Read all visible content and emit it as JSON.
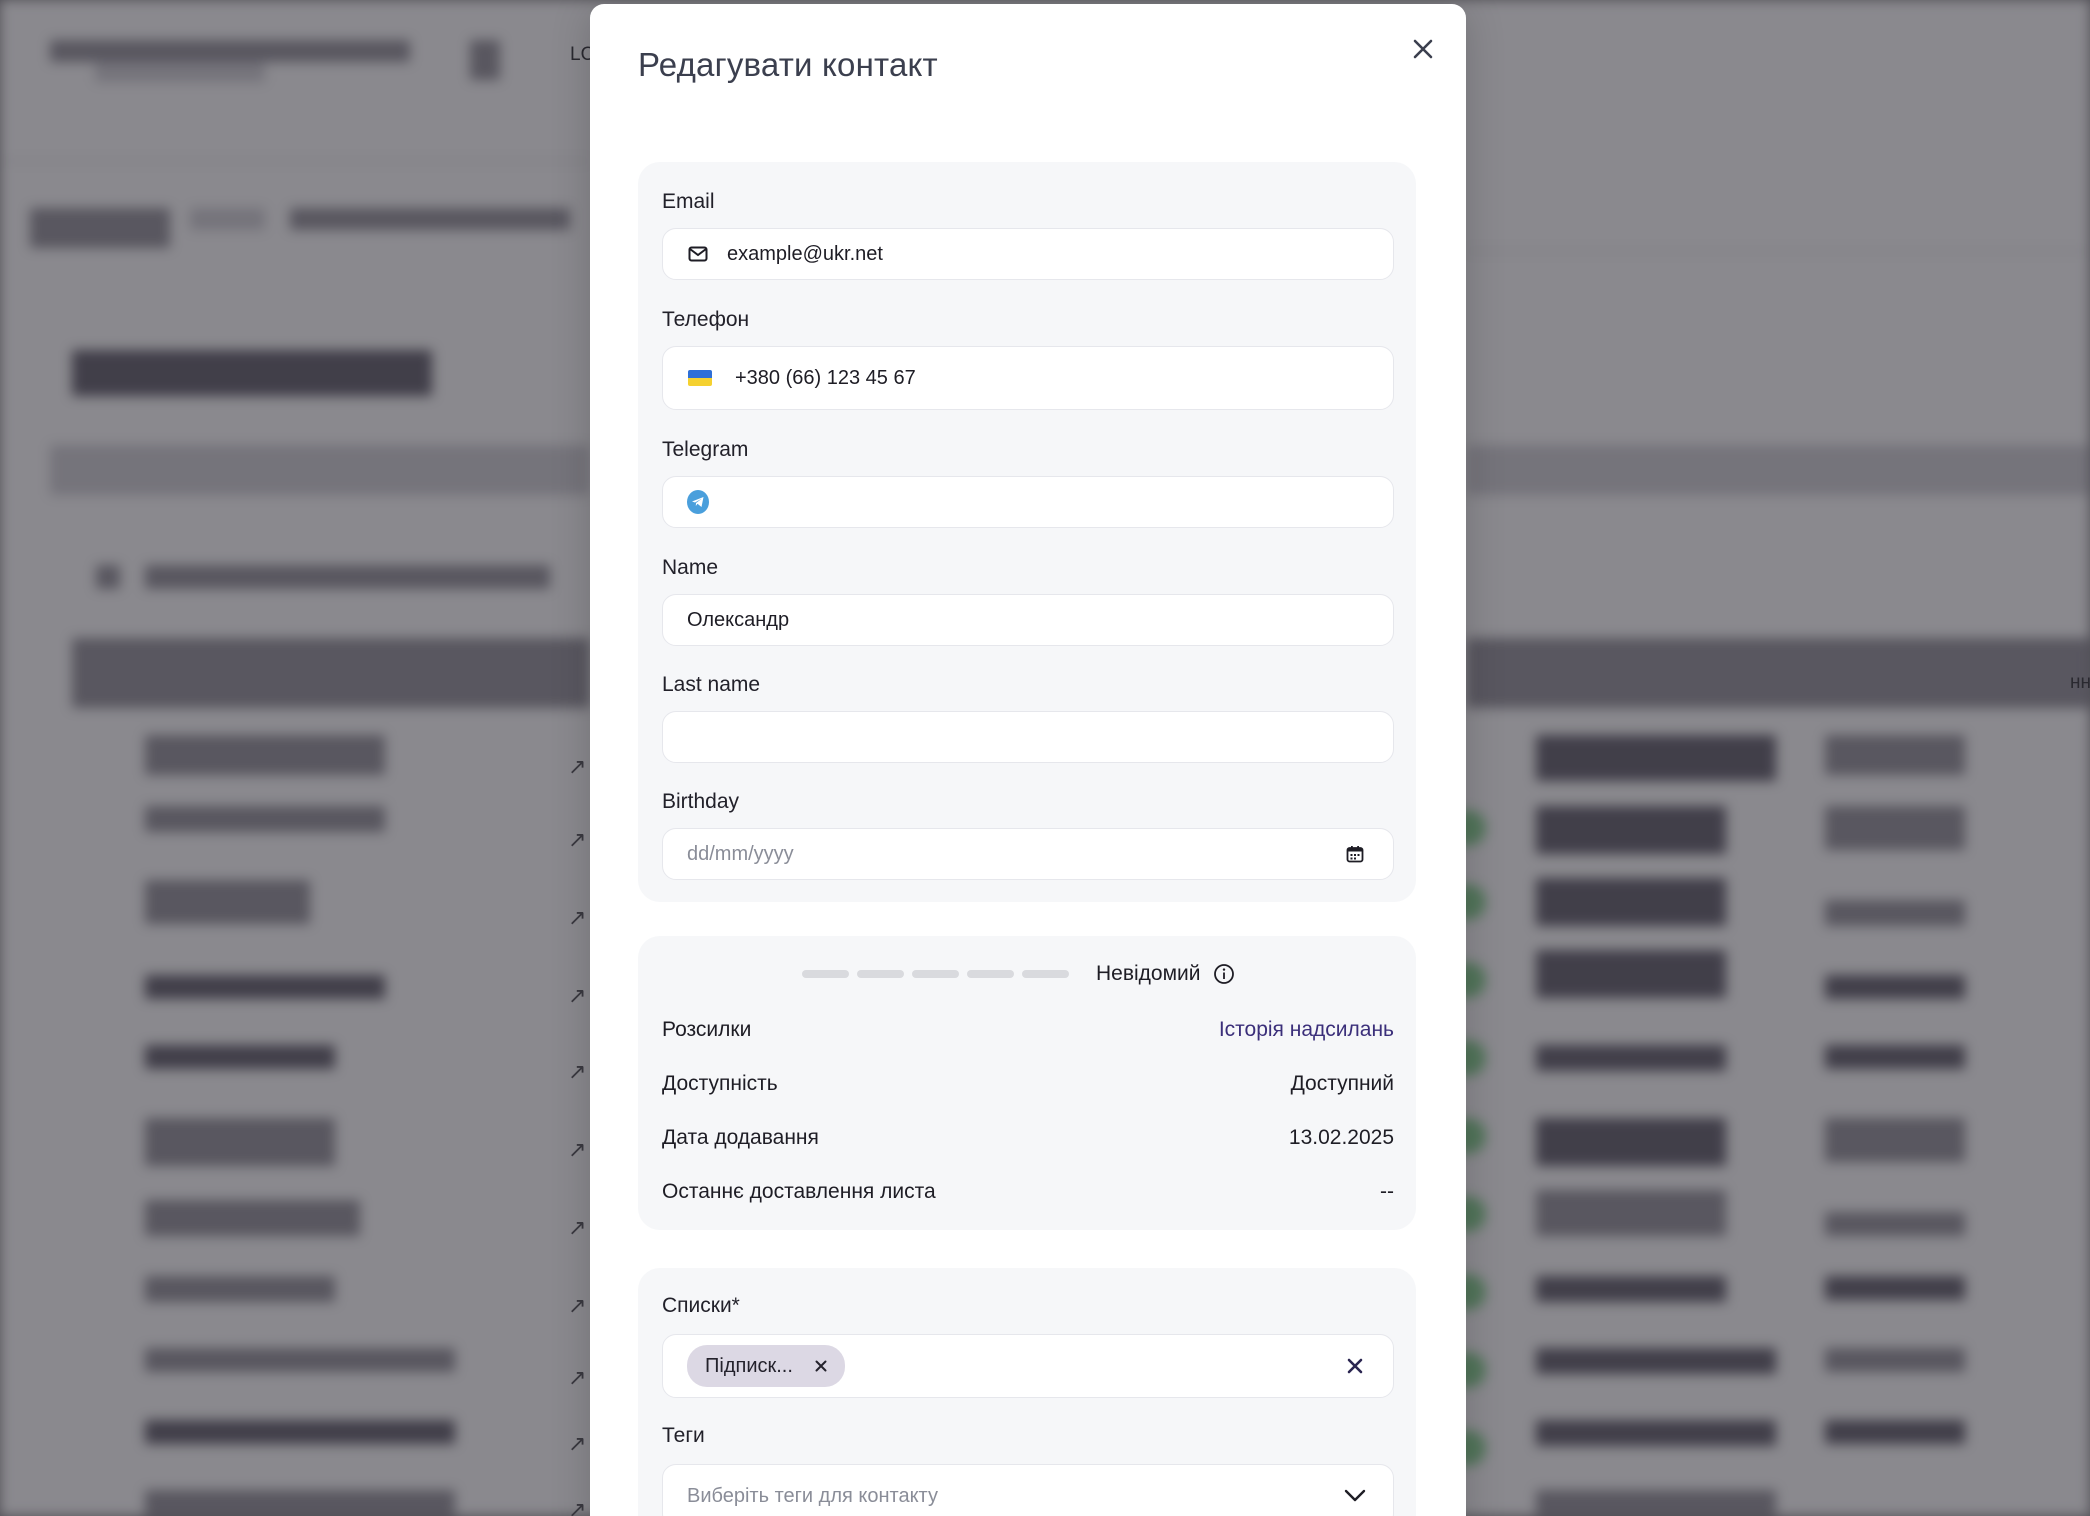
{
  "modal": {
    "title": "Редагувати контакт"
  },
  "fields": {
    "email": {
      "label": "Email",
      "value": "example@ukr.net"
    },
    "phone": {
      "label": "Телефон",
      "value": "+380 (66) 123 45 67",
      "flag_colors": [
        "#2f6fd6",
        "#f5d130"
      ]
    },
    "telegram": {
      "label": "Telegram",
      "value": ""
    },
    "name": {
      "label": "Name",
      "value": "Олександр"
    },
    "last_name": {
      "label": "Last name",
      "value": ""
    },
    "birthday": {
      "label": "Birthday",
      "placeholder": "dd/mm/yyyy"
    }
  },
  "stats": {
    "status": "Невідомий",
    "rows": [
      {
        "label": "Розсилки",
        "value": "Історія надсилань"
      },
      {
        "label": "Доступність",
        "value": "Доступний"
      },
      {
        "label": "Дата додавання",
        "value": "13.02.2025"
      },
      {
        "label": "Останнє доставлення листа",
        "value": "--"
      }
    ]
  },
  "lists": {
    "label": "Списки*",
    "chips": [
      "Підписк..."
    ]
  },
  "tags": {
    "label": "Теги",
    "placeholder": "Виберіть теги для контакту"
  },
  "background": {
    "partial_text_left": "LO",
    "partial_text_right": "нн"
  },
  "colors": {
    "accent_link": "#3b2f7a",
    "telegram": "#4a9fdc",
    "chip_bg": "#dcd8e4"
  }
}
